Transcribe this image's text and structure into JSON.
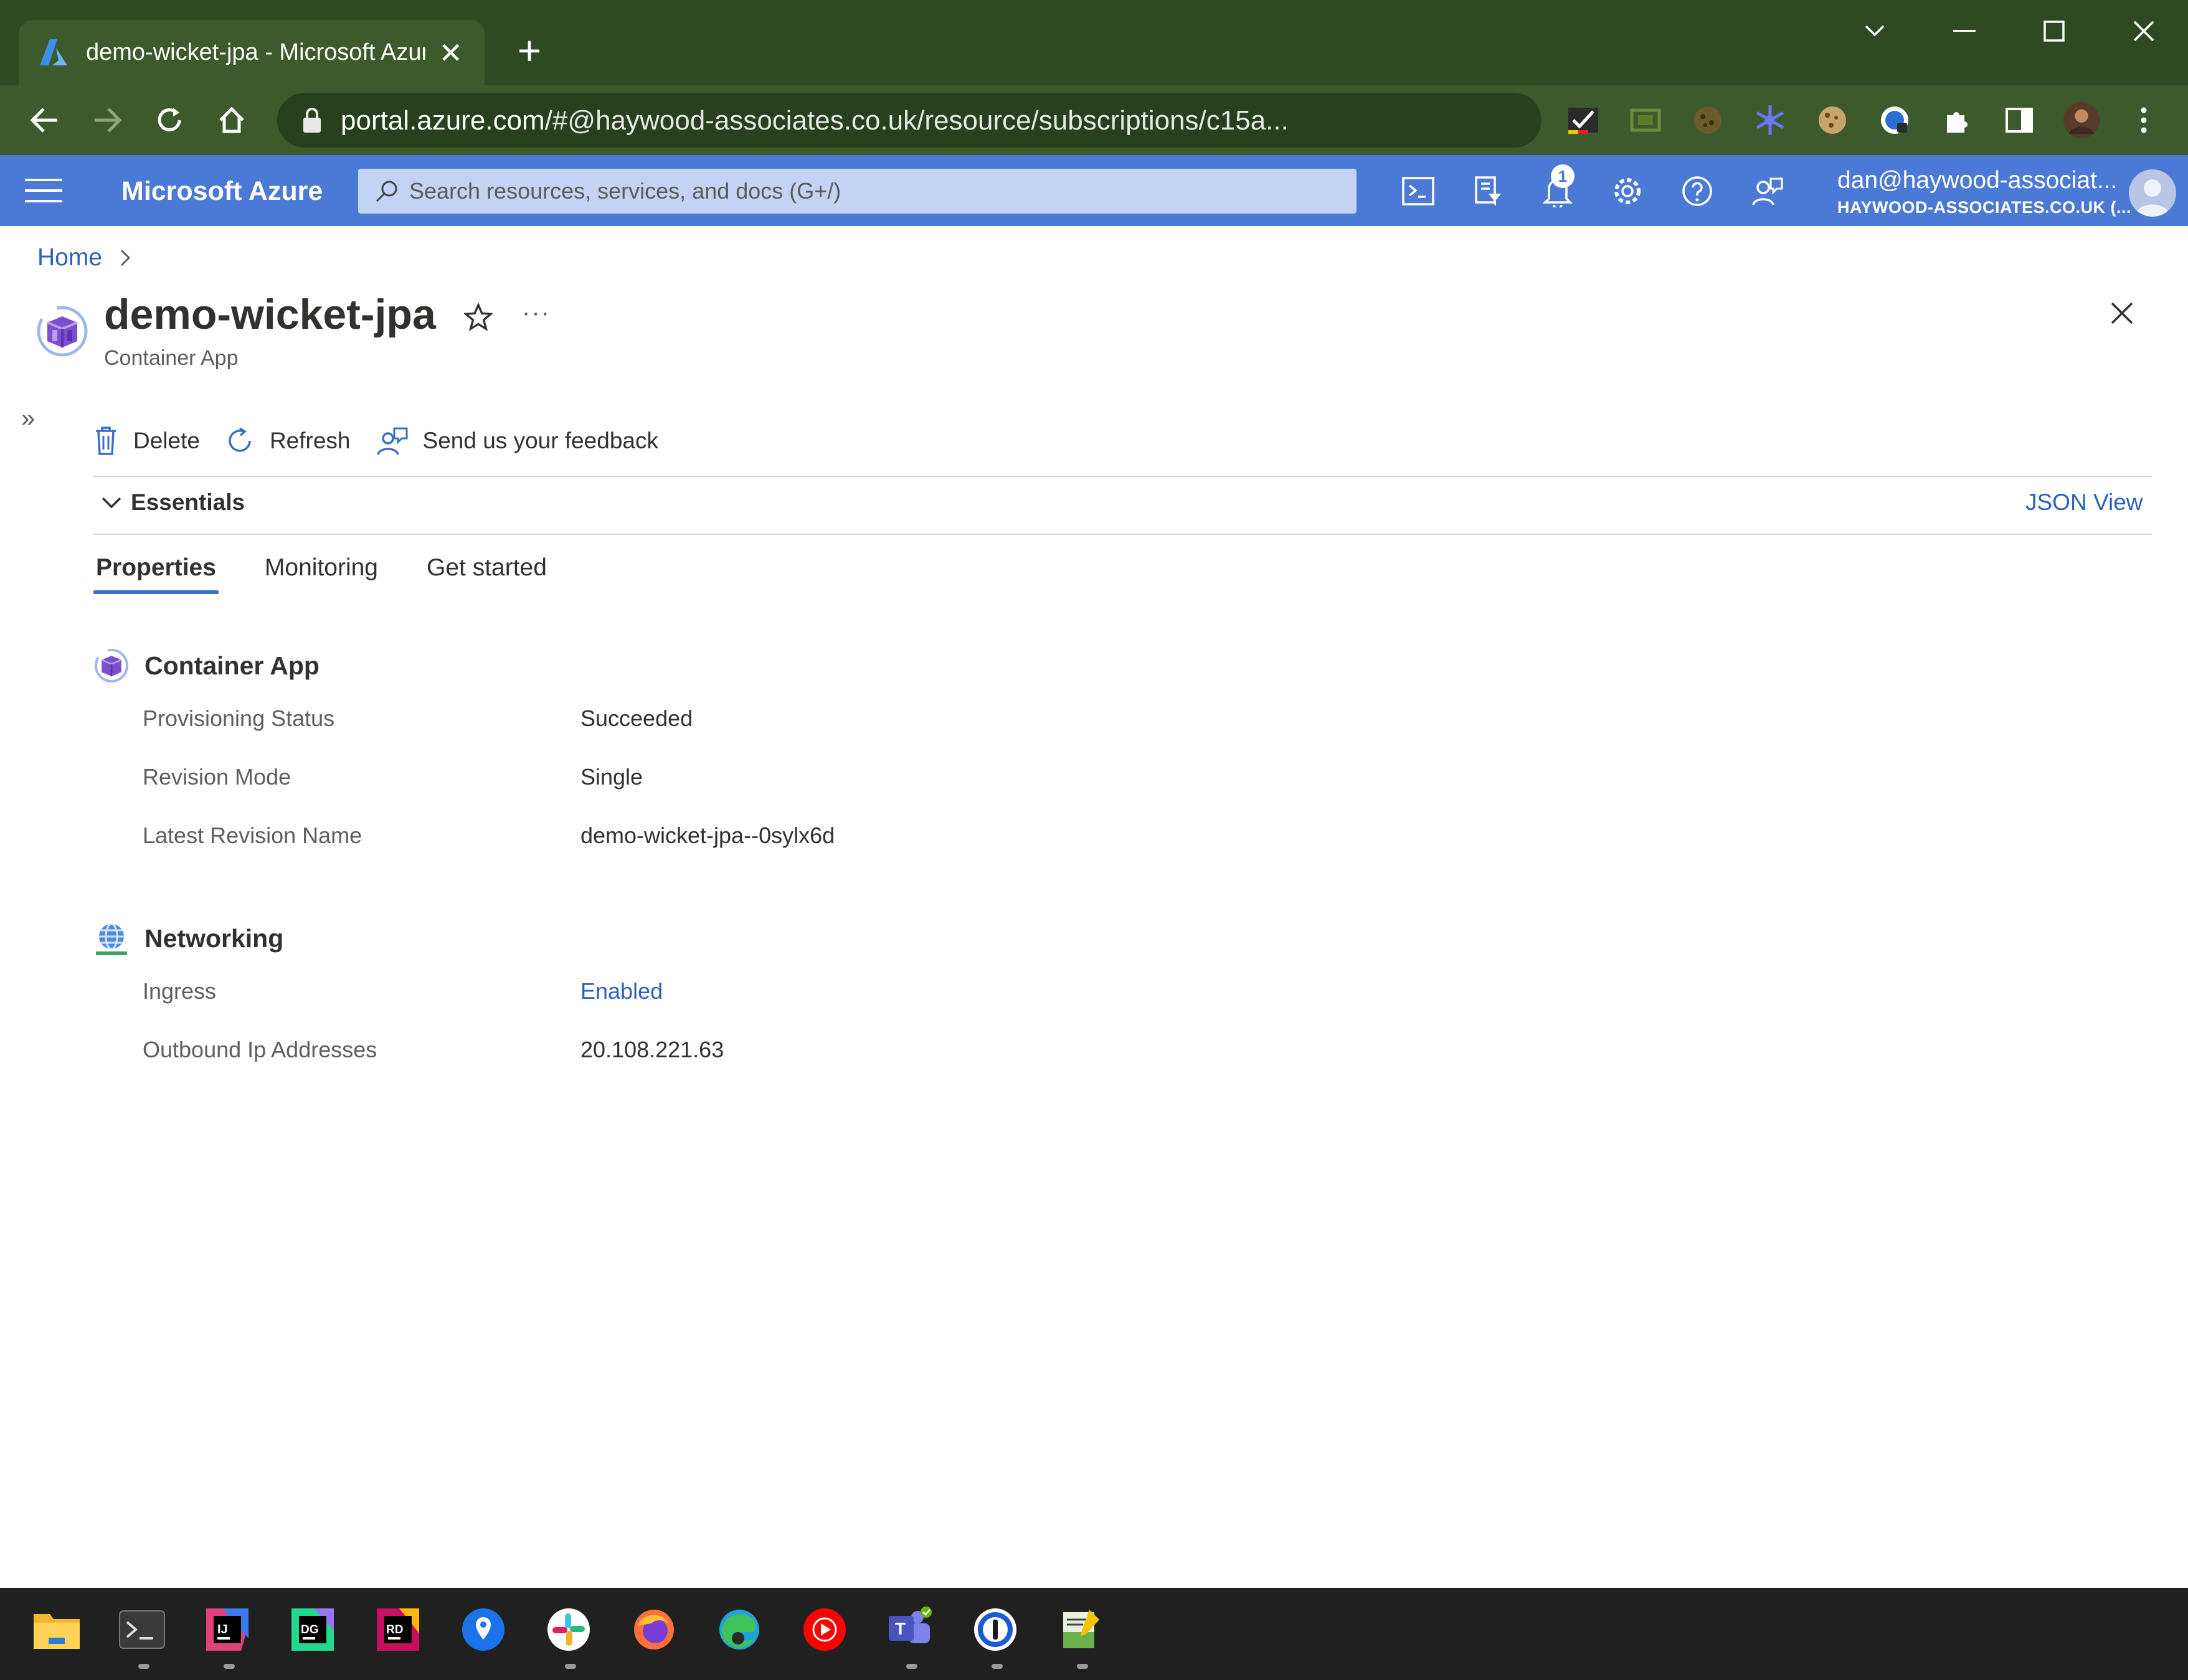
{
  "browser": {
    "tab_title": "demo-wicket-jpa - Microsoft Azure",
    "url_host": "portal.azure.com",
    "url_path": "/#@haywood-associates.co.uk/resource/subscriptions/c15a..."
  },
  "azure": {
    "brand": "Microsoft Azure",
    "search_placeholder": "Search resources, services, and docs (G+/)",
    "notification_count": "1",
    "account_name": "dan@haywood-associat...",
    "account_tenant": "HAYWOOD-ASSOCIATES.CO.UK (..."
  },
  "breadcrumb": {
    "home": "Home"
  },
  "resource": {
    "title": "demo-wicket-jpa",
    "subtitle": "Container App"
  },
  "commands": {
    "delete": "Delete",
    "refresh": "Refresh",
    "feedback": "Send us your feedback"
  },
  "essentials": {
    "label": "Essentials",
    "json_view": "JSON View"
  },
  "tabs": [
    {
      "label": "Properties",
      "active": true
    },
    {
      "label": "Monitoring",
      "active": false
    },
    {
      "label": "Get started",
      "active": false
    }
  ],
  "sections": {
    "container_app": {
      "title": "Container App",
      "rows": [
        {
          "label": "Provisioning Status",
          "value": "Succeeded"
        },
        {
          "label": "Revision Mode",
          "value": "Single"
        },
        {
          "label": "Latest Revision Name",
          "value": "demo-wicket-jpa--0sylx6d"
        }
      ]
    },
    "networking": {
      "title": "Networking",
      "rows": [
        {
          "label": "Ingress",
          "value": "Enabled"
        },
        {
          "label": "Outbound Ip Addresses",
          "value": "20.108.221.63"
        }
      ]
    }
  },
  "colors": {
    "azure_header": "#4b79d6",
    "browser_frame": "#3c5a2b",
    "link": "#2f5fbf",
    "taskbar": "#202020"
  },
  "taskbar_icons": [
    "file-explorer-icon",
    "terminal-icon",
    "intellij-icon",
    "datagrip-icon",
    "rider-icon",
    "maps-pin-icon",
    "slack-icon",
    "firefox-icon",
    "edge-icon",
    "youtube-music-icon",
    "teams-icon",
    "1password-icon",
    "notepad-icon"
  ]
}
